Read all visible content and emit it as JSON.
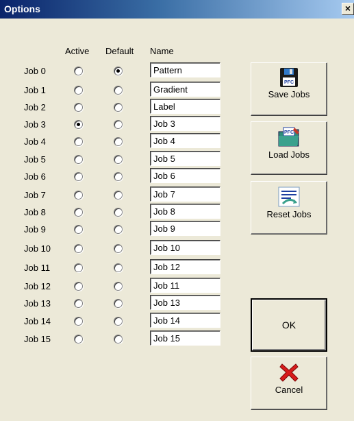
{
  "window": {
    "title": "Options",
    "close_label": "×"
  },
  "headers": {
    "active": "Active",
    "default": "Default",
    "name": "Name"
  },
  "jobs": [
    {
      "label": "Job 0",
      "name": "Pattern",
      "active": false,
      "default": true
    },
    {
      "label": "Job 1",
      "name": "Gradient",
      "active": false,
      "default": false
    },
    {
      "label": "Job 2",
      "name": "Label",
      "active": false,
      "default": false
    },
    {
      "label": "Job 3",
      "name": "Job 3",
      "active": true,
      "default": false
    },
    {
      "label": "Job 4",
      "name": "Job 4",
      "active": false,
      "default": false
    },
    {
      "label": "Job 5",
      "name": "Job 5",
      "active": false,
      "default": false
    },
    {
      "label": "Job 6",
      "name": "Job 6",
      "active": false,
      "default": false
    },
    {
      "label": "Job 7",
      "name": "Job 7",
      "active": false,
      "default": false
    },
    {
      "label": "Job 8",
      "name": "Job 8",
      "active": false,
      "default": false
    },
    {
      "label": "Job 9",
      "name": "Job 9",
      "active": false,
      "default": false
    },
    {
      "label": "Job 10",
      "name": "Job 10",
      "active": false,
      "default": false
    },
    {
      "label": "Job 11",
      "name": "Job 12",
      "active": false,
      "default": false
    },
    {
      "label": "Job 12",
      "name": "Job 11",
      "active": false,
      "default": false
    },
    {
      "label": "Job 13",
      "name": "Job 13",
      "active": false,
      "default": false
    },
    {
      "label": "Job 14",
      "name": "Job 14",
      "active": false,
      "default": false
    },
    {
      "label": "Job 15",
      "name": "Job 15",
      "active": false,
      "default": false
    }
  ],
  "buttons": {
    "save": {
      "label": "Save Jobs",
      "icon": "floppy-disk-icon",
      "icon_text": "PFC"
    },
    "load": {
      "label": "Load Jobs",
      "icon": "folder-icon",
      "icon_text": "PFC"
    },
    "reset": {
      "label": "Reset Jobs",
      "icon": "reset-icon"
    },
    "ok": {
      "label": "OK"
    },
    "cancel": {
      "label": "Cancel",
      "icon": "red-x-icon"
    }
  },
  "colors": {
    "title_start": "#0a246a",
    "title_end": "#a6caf0",
    "dialog_bg": "#ece9d8",
    "cancel_x": "#e01010"
  }
}
